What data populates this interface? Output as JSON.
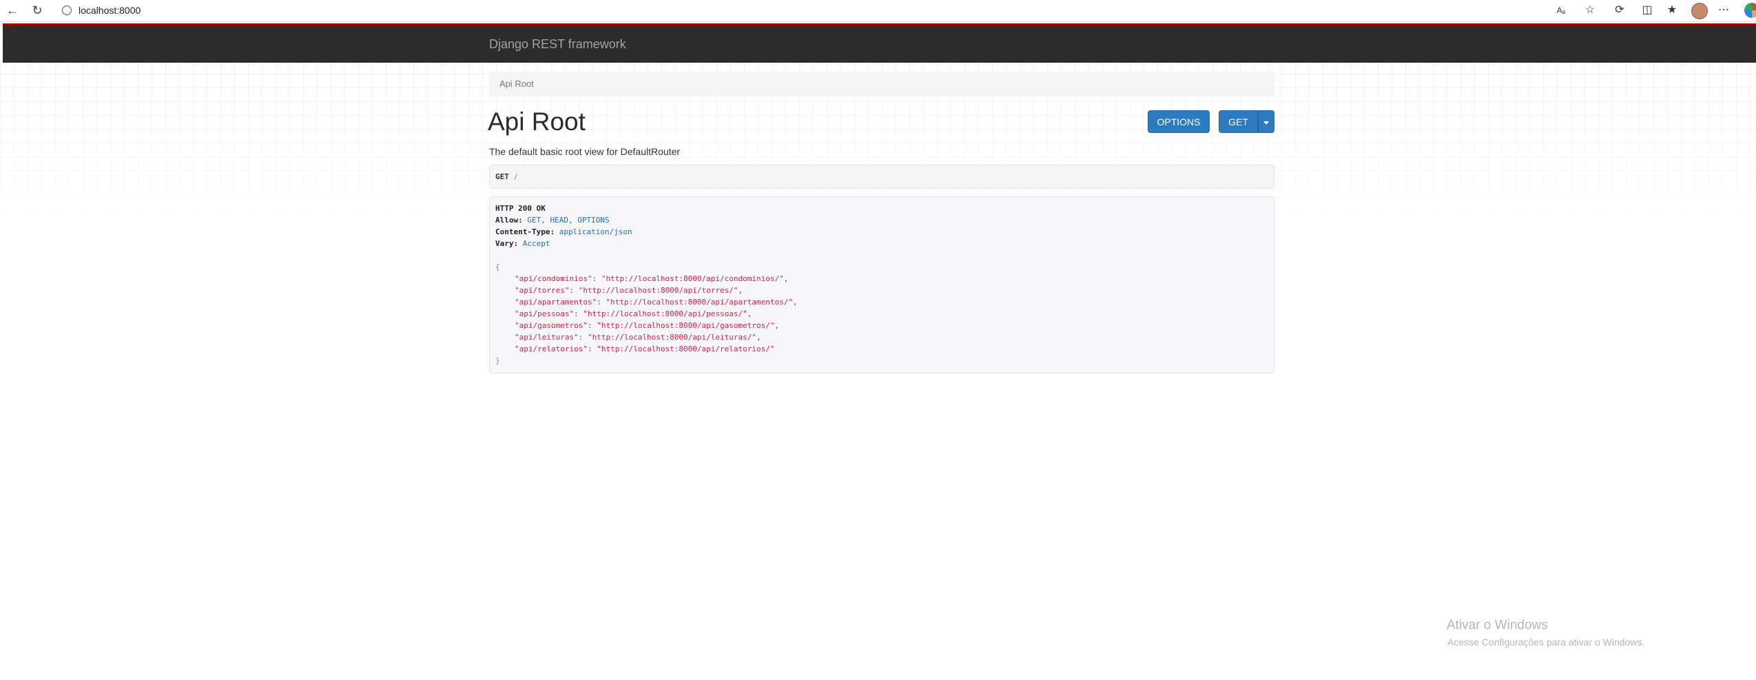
{
  "browser": {
    "url": "localhost:8000"
  },
  "app": {
    "brand": "Django REST framework"
  },
  "breadcrumb": {
    "current": "Api Root"
  },
  "page": {
    "title": "Api Root",
    "description": "The default basic root view for DefaultRouter",
    "options_label": "OPTIONS",
    "get_label": "GET"
  },
  "request": {
    "method": "GET",
    "path": "/"
  },
  "response": {
    "status": "HTTP 200 OK",
    "headers": [
      {
        "key": "Allow:",
        "value": "GET, HEAD, OPTIONS"
      },
      {
        "key": "Content-Type:",
        "value": "application/json"
      },
      {
        "key": "Vary:",
        "value": "Accept"
      }
    ],
    "open_brace": "{",
    "close_brace": "}",
    "body": [
      {
        "key": "\"api/condominios\"",
        "value": "\"http://localhost:8000/api/condominios/\"",
        "sep": ","
      },
      {
        "key": "\"api/torres\"",
        "value": "\"http://localhost:8000/api/torres/\"",
        "sep": ","
      },
      {
        "key": "\"api/apartamentos\"",
        "value": "\"http://localhost:8000/api/apartamentos/\"",
        "sep": ","
      },
      {
        "key": "\"api/pessoas\"",
        "value": "\"http://localhost:8000/api/pessoas/\"",
        "sep": ","
      },
      {
        "key": "\"api/gasometros\"",
        "value": "\"http://localhost:8000/api/gasometros/\"",
        "sep": ","
      },
      {
        "key": "\"api/leituras\"",
        "value": "\"http://localhost:8000/api/leituras/\"",
        "sep": ","
      },
      {
        "key": "\"api/relatorios\"",
        "value": "\"http://localhost:8000/api/relatorios/\"",
        "sep": ""
      }
    ]
  },
  "watermark": {
    "title": "Ativar o Windows",
    "subtitle": "Acesse Configurações para ativar o Windows."
  },
  "colors": {
    "navbar": "#2c2c2c",
    "navbar_accent": "#a30000",
    "button": "#2c7bbf",
    "json_string": "#c7254e",
    "header_value": "#1f6fb2"
  },
  "icons": [
    "back-arrow-icon",
    "reload-icon",
    "site-info-icon",
    "read-aloud-icon",
    "favorite-star-icon",
    "extensions-icon",
    "split-screen-icon",
    "favorites-icon",
    "profile-avatar",
    "more-menu-icon",
    "copilot-icon"
  ]
}
